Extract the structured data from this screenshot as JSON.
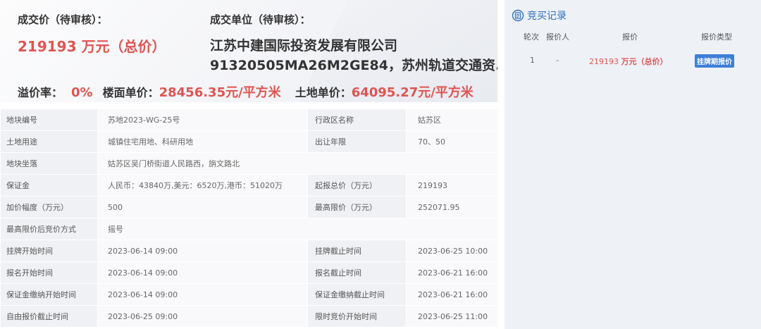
{
  "summary": {
    "deal_price_label": "成交价（待审核）：",
    "deal_price_value": "219193 万元（总价）",
    "deal_unit_label": "成交单位（待审核）：",
    "company_line1": "江苏中建国际投资发展有限公司",
    "company_line2": "91320505MA26M2GE84，苏州轨道交通资...",
    "premium_label": "溢价率：",
    "premium_value": "0%",
    "floor_price_label": "楼面单价：",
    "floor_price_value": "28456.35元/平方米",
    "land_price_label": "土地单价：",
    "land_price_value": "64095.27元/平方米"
  },
  "table": {
    "rows": [
      {
        "k1": "地块编号",
        "v1": "苏地2023-WG-25号",
        "k2": "行政区名称",
        "v2": "姑苏区"
      },
      {
        "k1": "土地用途",
        "v1": "城镇住宅用地、科研用地",
        "k2": "出让年限",
        "v2": "70、50"
      },
      {
        "k1": "地块坐落",
        "v1": "姑苏区吴门桥街道人民路西，旃文路北"
      },
      {
        "k1": "保证金",
        "v1": "人民币：43840万,美元：6520万,港币：51020万",
        "k2": "起报总价（万元）",
        "v2": "219193"
      },
      {
        "k1": "加价幅度（万元）",
        "v1": "500",
        "k2": "最高限价（万元）",
        "v2": "252071.95"
      },
      {
        "k1": "最高限价后竞价方式",
        "v1": "摇号"
      },
      {
        "k1": "挂牌开始时间",
        "v1": "2023-06-14 09:00",
        "k2": "挂牌截止时间",
        "v2": "2023-06-25 10:00"
      },
      {
        "k1": "报名开始时间",
        "v1": "2023-06-14 09:00",
        "k2": "报名截止时间",
        "v2": "2023-06-21 16:00"
      },
      {
        "k1": "保证金缴纳开始时间",
        "v1": "2023-06-14 09:00",
        "k2": "保证金缴纳截止时间",
        "v2": "2023-06-21 16:00"
      },
      {
        "k1": "自由报价截止时间",
        "v1": "2023-06-25 09:00",
        "k2": "限时竞价开始时间",
        "v2": "2023-06-25 11:00"
      }
    ]
  },
  "record": {
    "title": "竞买记录",
    "icon": "document-icon",
    "headers": {
      "round": "轮次",
      "bidder": "报价人",
      "price": "报价",
      "type": "报价类型"
    },
    "rows": [
      {
        "round": "1",
        "bidder": "-",
        "price_num": "219193",
        "price_unit": "万元（总价）",
        "type": "挂牌期报价"
      }
    ]
  },
  "colors": {
    "accent_red": "#e05451",
    "accent_blue": "#2f6fbf",
    "badge_blue": "#3d7fd8"
  }
}
